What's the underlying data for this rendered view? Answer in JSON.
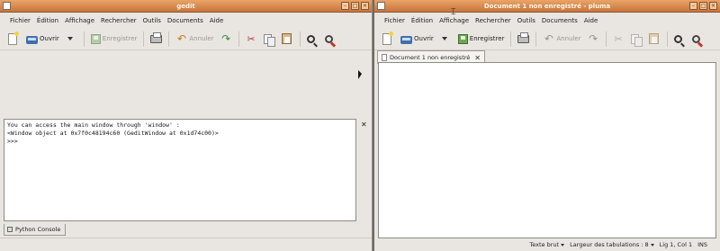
{
  "left_window": {
    "title": "gedit",
    "menu": [
      "Fichier",
      "Édition",
      "Affichage",
      "Rechercher",
      "Outils",
      "Documents",
      "Aide"
    ],
    "toolbar": {
      "open_label": "Ouvrir",
      "save_label": "Enregistrer",
      "undo_label": "Annuler"
    },
    "console": {
      "lines": [
        "You can access the main window through 'window' :",
        "<Window object at 0x7f0c48194c60 (GeditWindow at 0x1d74c00)>",
        ">>>"
      ]
    },
    "bottom_tab": "Python Console"
  },
  "right_window": {
    "title": "Document 1 non enregistré - pluma",
    "menu": [
      "Fichier",
      "Édition",
      "Affichage",
      "Rechercher",
      "Outils",
      "Documents",
      "Aide"
    ],
    "toolbar": {
      "open_label": "Ouvrir",
      "save_label": "Enregistrer",
      "undo_label": "Annuler"
    },
    "tab_label": "Document 1 non enregistré",
    "status": {
      "syntax": "Texte brut",
      "tab_width": "Largeur des tabulations : 8",
      "position": "Lig 1, Col 1",
      "mode": "INS"
    }
  },
  "colors": {
    "titlebar_top": "#e9a466",
    "titlebar_bottom": "#c8743c",
    "window_bg": "#e9e6e1"
  }
}
